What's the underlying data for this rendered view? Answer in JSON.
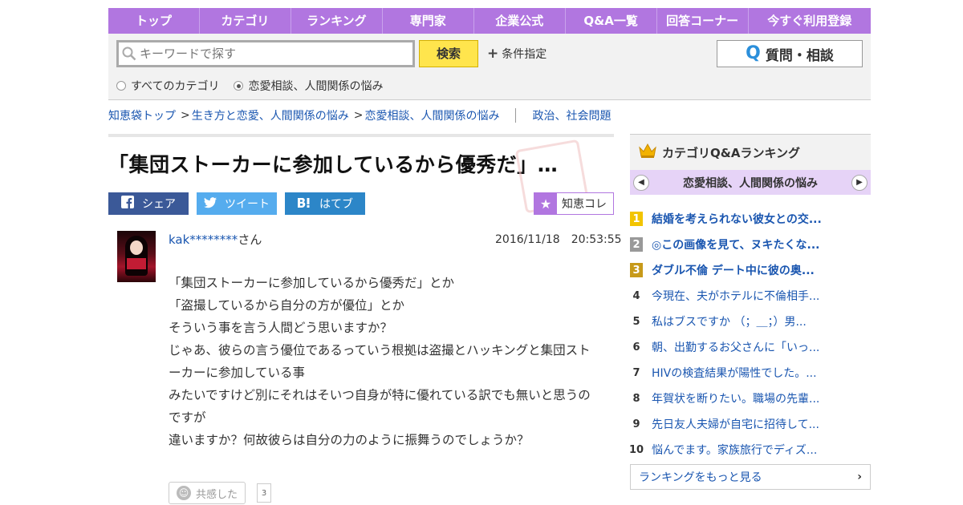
{
  "nav": {
    "items": [
      "トップ",
      "カテゴリ",
      "ランキング",
      "専門家",
      "企業公式",
      "Q&A一覧",
      "回答コーナー",
      "今すぐ利用登録"
    ]
  },
  "search": {
    "placeholder": "キーワードで探す",
    "button_label": "検索",
    "condition_label": "条件指定",
    "ask_label": "質問・相談",
    "radio_all": "すべてのカテゴリ",
    "radio_current": "恋愛相談、人間関係の悩み"
  },
  "breadcrumb": {
    "items": [
      "知恵袋トップ",
      "生き方と恋愛、人間関係の悩み",
      "恋愛相談、人間関係の悩み"
    ],
    "separator": ">",
    "related": "政治、社会問題"
  },
  "question": {
    "title": "「集団ストーカーに参加しているから優秀だ」…",
    "author_name": "kak********",
    "author_suffix": "さん",
    "datetime": "2016/11/18　20:53:55",
    "body_lines": [
      "「集団ストーカーに参加しているから優秀だ」とか",
      "「盗撮しているから自分の方が優位」とか",
      "そういう事を言う人間どう思いますか？",
      "じゃあ、彼らの言う優位であるっていう根拠は盗撮とハッキングと集団ストーカーに参加している事",
      "みたいですけど別にそれはそいつ自身が特に優れている訳でも無いと思うのですが",
      "違いますか？何故彼らは自分の力のように振舞うのでしょうか？"
    ],
    "kyokan_label": "共感した",
    "kyokan_count": "3"
  },
  "share": {
    "facebook": "シェア",
    "twitter": "ツイート",
    "hatena": "はてブ",
    "chiekore": "知恵コレ"
  },
  "sidebar": {
    "title": "カテゴリQ&Aランキング",
    "category": "恋愛相談、人間関係の悩み",
    "ranking": [
      {
        "rank": "1",
        "text": "結婚を考えられない彼女との交..."
      },
      {
        "rank": "2",
        "text": "◎この画像を見て、ヌキたくな..."
      },
      {
        "rank": "3",
        "text": "ダブル不倫 デート中に彼の奥..."
      },
      {
        "rank": "4",
        "text": "今現在、夫がホテルに不倫相手..."
      },
      {
        "rank": "5",
        "text": "私はブスですか （；＿；）男..."
      },
      {
        "rank": "6",
        "text": "朝、出勤するお父さんに「いっ..."
      },
      {
        "rank": "7",
        "text": "HIVの検査結果が陽性でした。..."
      },
      {
        "rank": "8",
        "text": "年賀状を断りたい。職場の先輩..."
      },
      {
        "rank": "9",
        "text": "先日友人夫婦が自宅に招待して..."
      },
      {
        "rank": "10",
        "text": "悩んでます。家族旅行でディズ..."
      }
    ],
    "more_label": "ランキングをもっと見る"
  },
  "colors": {
    "nav_purple": "#b176e0",
    "link_blue": "#1a56b0",
    "search_yellow": "#ffe54d"
  }
}
